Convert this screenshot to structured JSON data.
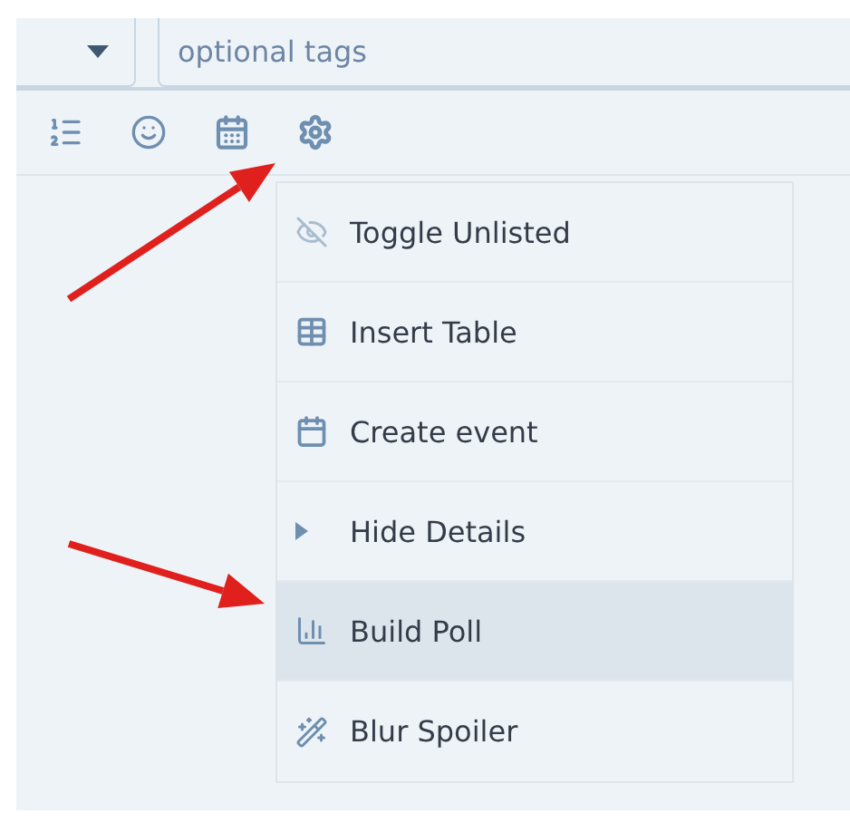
{
  "tags_field": {
    "placeholder": "optional tags"
  },
  "toolbar": [
    {
      "kind": "list"
    },
    {
      "kind": "emoji"
    },
    {
      "kind": "calendar"
    },
    {
      "kind": "settings"
    }
  ],
  "menu": {
    "items": [
      {
        "label": "Toggle Unlisted",
        "kind": "unlisted",
        "selected": false
      },
      {
        "label": "Insert Table",
        "kind": "table",
        "selected": false
      },
      {
        "label": "Create event",
        "kind": "event",
        "selected": false
      },
      {
        "label": "Hide Details",
        "kind": "details",
        "selected": false
      },
      {
        "label": "Build Poll",
        "kind": "poll",
        "selected": true
      },
      {
        "label": "Blur Spoiler",
        "kind": "spoiler",
        "selected": false
      }
    ]
  },
  "annotations": [
    {
      "kind": "arrow"
    },
    {
      "kind": "arrow"
    }
  ]
}
